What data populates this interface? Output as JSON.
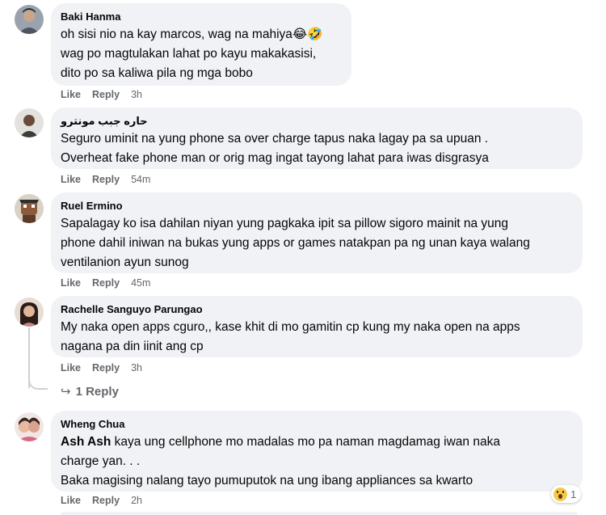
{
  "comments": [
    {
      "author": "Baki Hanma",
      "text": "oh sisi nio na kay marcos, wag na mahiya😂🤣\nwag po magtulakan lahat po kayu makakasisi,\ndito po sa kaliwa pila ng mga bobo",
      "like": "Like",
      "reply": "Reply",
      "time": "3h"
    },
    {
      "author": "حاره جبب مونترو",
      "text": "Seguro uminit na yung phone sa over charge tapus naka lagay pa sa upuan .\nOverheat fake phone man or orig mag ingat tayong lahat para iwas disgrasya",
      "like": "Like",
      "reply": "Reply",
      "time": "54m"
    },
    {
      "author": "Ruel Ermino",
      "text": "Sapalagay ko isa dahilan niyan yung pagkaka ipit sa pillow sigoro mainit na yung\nphone dahil iniwan na bukas yung apps or games natakpan pa ng unan kaya walang\nventilanion ayun sunog",
      "like": "Like",
      "reply": "Reply",
      "time": "45m"
    },
    {
      "author": "Rachelle Sanguyo Parungao",
      "text": "My naka open apps cguro,, kase khit di mo gamitin cp kung my naka open na apps\nnagana pa din iinit ang cp",
      "like": "Like",
      "reply": "Reply",
      "time": "3h",
      "replies_label": "1 Reply"
    },
    {
      "author": "Wheng Chua",
      "mention": "Ash Ash",
      "text": " kaya ung cellphone mo madalas mo pa naman magdamag iwan naka\ncharge yan. . .\nBaka magising nalang tayo pumuputok na ung ibang appliances sa kwarto",
      "like": "Like",
      "reply": "Reply",
      "time": "2h",
      "reaction_icon": "wow-emoji-icon",
      "reaction_count": "1"
    }
  ],
  "colors": {
    "bubble": "#f0f2f5",
    "text": "#050505",
    "meta": "#65676b"
  }
}
